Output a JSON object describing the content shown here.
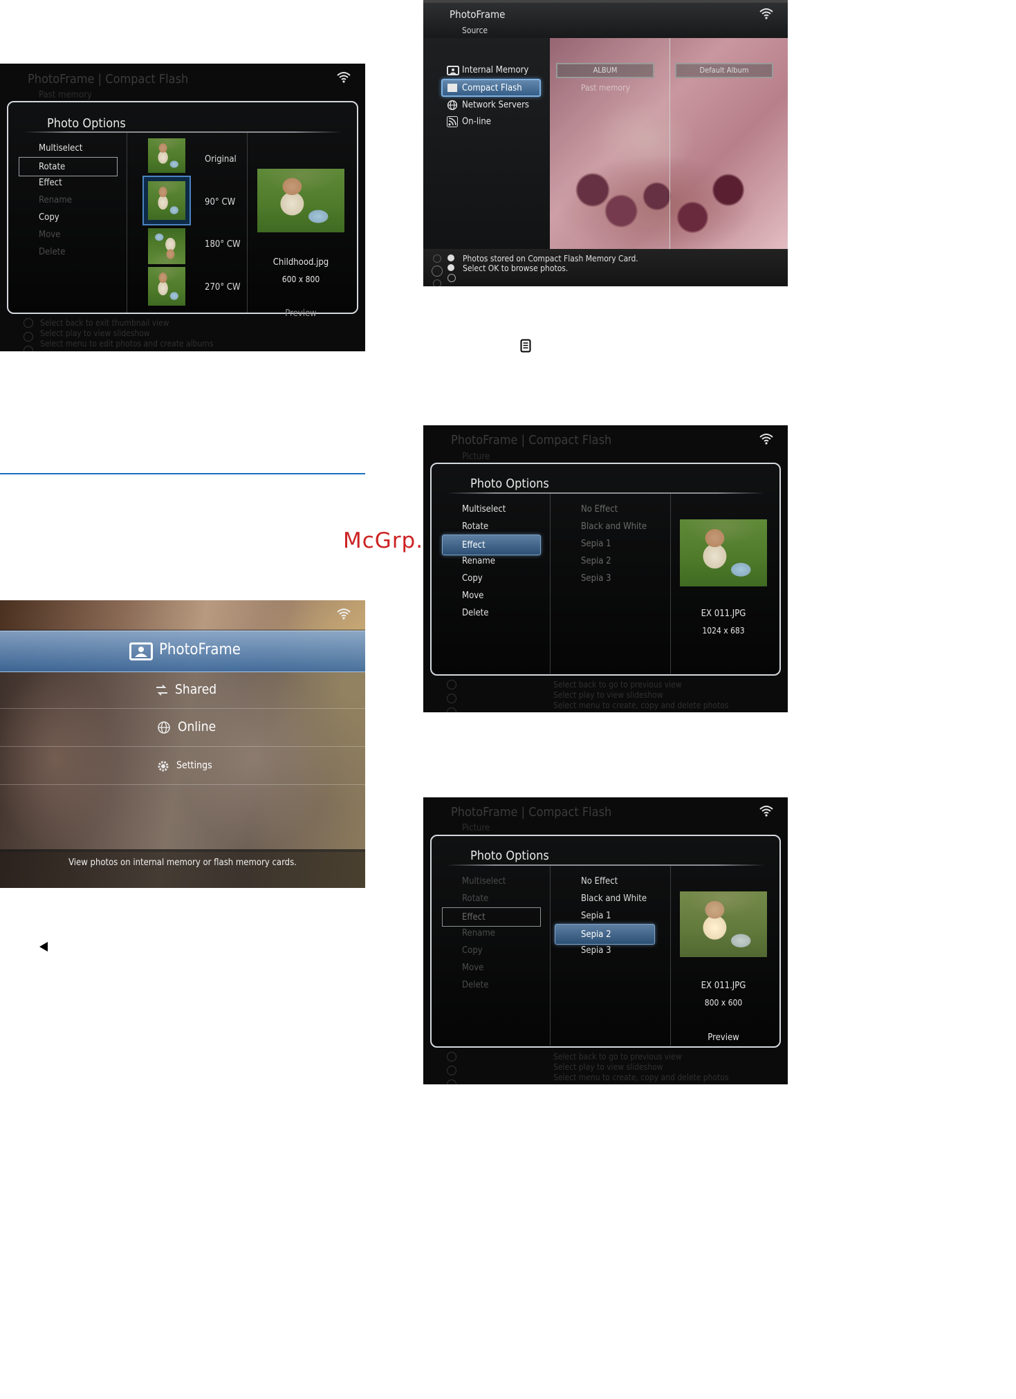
{
  "watermark": "McGrp.Ru",
  "icons": {
    "wifi": "wifi-icon",
    "menu_key": "menu-key-icon",
    "left_arrow": "left-arrow-icon"
  },
  "screen_rotate": {
    "title": "PhotoFrame | Compact Flash",
    "subtitle": "Past memory",
    "panel_title": "Photo Options",
    "menu": [
      "Multiselect",
      "Rotate",
      "Effect",
      "Rename",
      "Copy",
      "Move",
      "Delete"
    ],
    "selected_menu": "Rotate",
    "options": [
      "Original",
      "90° CW",
      "180° CW",
      "270° CW"
    ],
    "selected_option": "90° CW",
    "filename": "Childhood.jpg",
    "dimensions": "600 x 800",
    "preview_label": "Preview",
    "hints": [
      "Select back to exit thumbnail view",
      "Select play to view slideshow",
      "Select menu to edit photos and create albums"
    ]
  },
  "screen_source": {
    "title": "PhotoFrame",
    "subtitle": "Source",
    "sources": [
      "Internal Memory",
      "Compact Flash",
      "Network Servers",
      "On-line"
    ],
    "selected_source": "Compact Flash",
    "album_label": "ALBUM",
    "album_sub": "Past memory",
    "default_album": "Default Album",
    "hints": [
      "Photos stored on Compact Flash Memory Card.",
      "Select OK to browse photos."
    ]
  },
  "screen_home": {
    "items": [
      "PhotoFrame",
      "Shared",
      "Online",
      "Settings"
    ],
    "selected_item": "PhotoFrame",
    "status": "View photos on internal memory or flash memory cards."
  },
  "screen_effect_a": {
    "title": "PhotoFrame | Compact Flash",
    "subtitle": "Picture",
    "panel_title": "Photo Options",
    "menu": [
      "Multiselect",
      "Rotate",
      "Effect",
      "Rename",
      "Copy",
      "Move",
      "Delete"
    ],
    "selected_menu": "Effect",
    "options": [
      "No Effect",
      "Black and White",
      "Sepia 1",
      "Sepia 2",
      "Sepia 3"
    ],
    "filename": "EX 011.JPG",
    "dimensions": "1024 x 683",
    "hints": [
      "Select back to go to previous view",
      "Select play to view slideshow",
      "Select menu to create, copy and delete photos"
    ]
  },
  "screen_effect_b": {
    "title": "PhotoFrame | Compact Flash",
    "subtitle": "Picture",
    "panel_title": "Photo Options",
    "menu": [
      "Multiselect",
      "Rotate",
      "Effect",
      "Rename",
      "Copy",
      "Move",
      "Delete"
    ],
    "selected_menu": "Effect",
    "options": [
      "No Effect",
      "Black and White",
      "Sepia 1",
      "Sepia 2",
      "Sepia 3"
    ],
    "selected_option": "Sepia 2",
    "filename": "EX 011.JPG",
    "dimensions": "800 x 600",
    "preview_label": "Preview",
    "hints": [
      "Select back to go to previous view",
      "Select play to view slideshow",
      "Select menu to create, copy and delete photos"
    ]
  },
  "colors": {
    "selection_blue": "#3f6690",
    "accent_line": "#1a6fc0",
    "watermark": "#cc2222"
  }
}
